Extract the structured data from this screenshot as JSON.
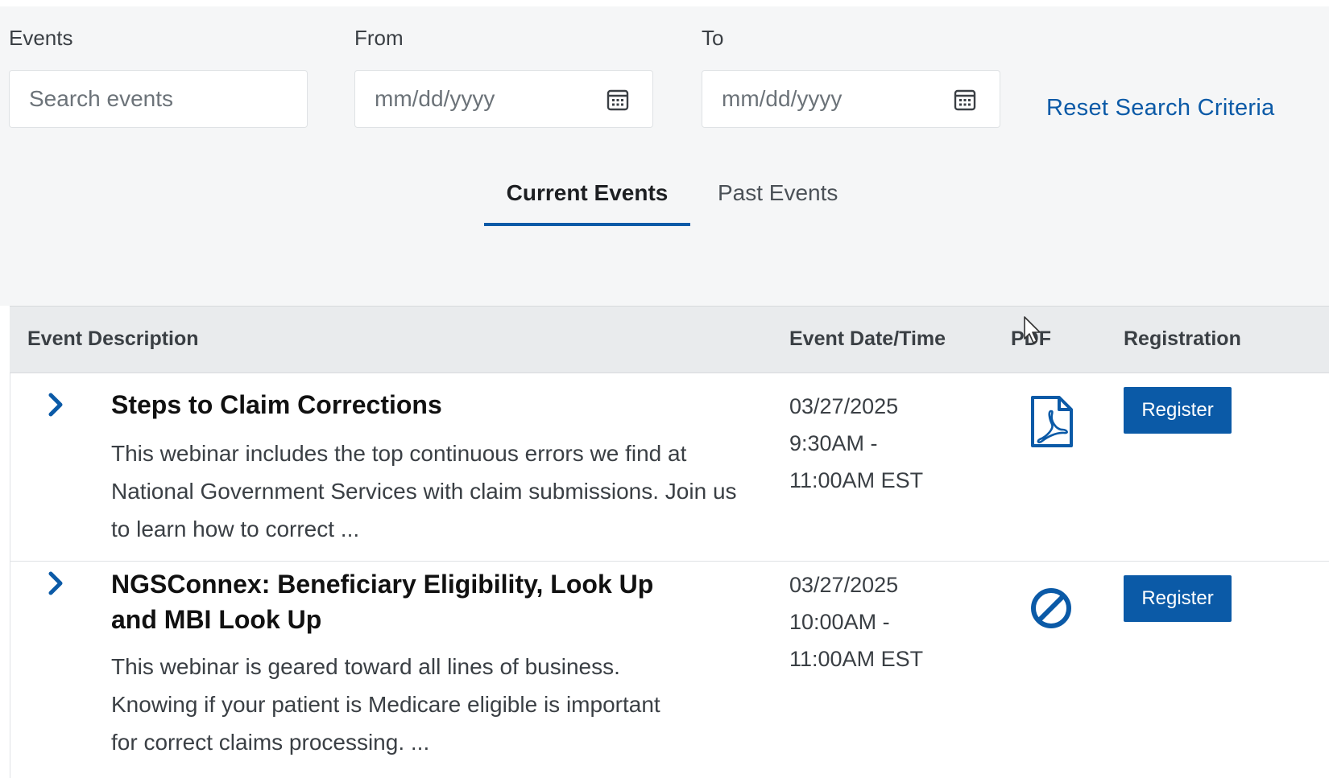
{
  "filters": {
    "events_label": "Events",
    "events_placeholder": "Search events",
    "from_label": "From",
    "from_placeholder": "mm/dd/yyyy",
    "to_label": "To",
    "to_placeholder": "mm/dd/yyyy",
    "reset_link": "Reset Search Criteria"
  },
  "tabs": [
    {
      "label": "Current Events",
      "selected": true
    },
    {
      "label": "Past Events",
      "selected": false
    }
  ],
  "table": {
    "columns": [
      "Event Description",
      "Event Date/Time",
      "PDF",
      "Registration"
    ],
    "rows": [
      {
        "title": "Steps to Claim Corrections",
        "description": "This webinar includes the top continuous errors we find at National Government Services with claim submissions. Join us to learn how to correct ...",
        "date": "03/27/2025",
        "time_start": "9:30AM -",
        "time_end": "11:00AM EST",
        "pdf_icon": "pdf-file-icon",
        "register_label": "Register"
      },
      {
        "title": "NGSConnex: Beneficiary Eligibility, Look Up and MBI Look Up",
        "description": "This webinar is geared toward all lines of business. Knowing if your patient is Medicare eligible is important for correct claims processing. ...",
        "date": "03/27/2025",
        "time_start": "10:00AM -",
        "time_end": "11:00AM EST",
        "pdf_icon": "not-available-icon",
        "register_label": "Register"
      }
    ]
  },
  "colors": {
    "accent": "#0b5aa7",
    "background": "#f5f6f7",
    "header_bg": "#e9ebed"
  }
}
